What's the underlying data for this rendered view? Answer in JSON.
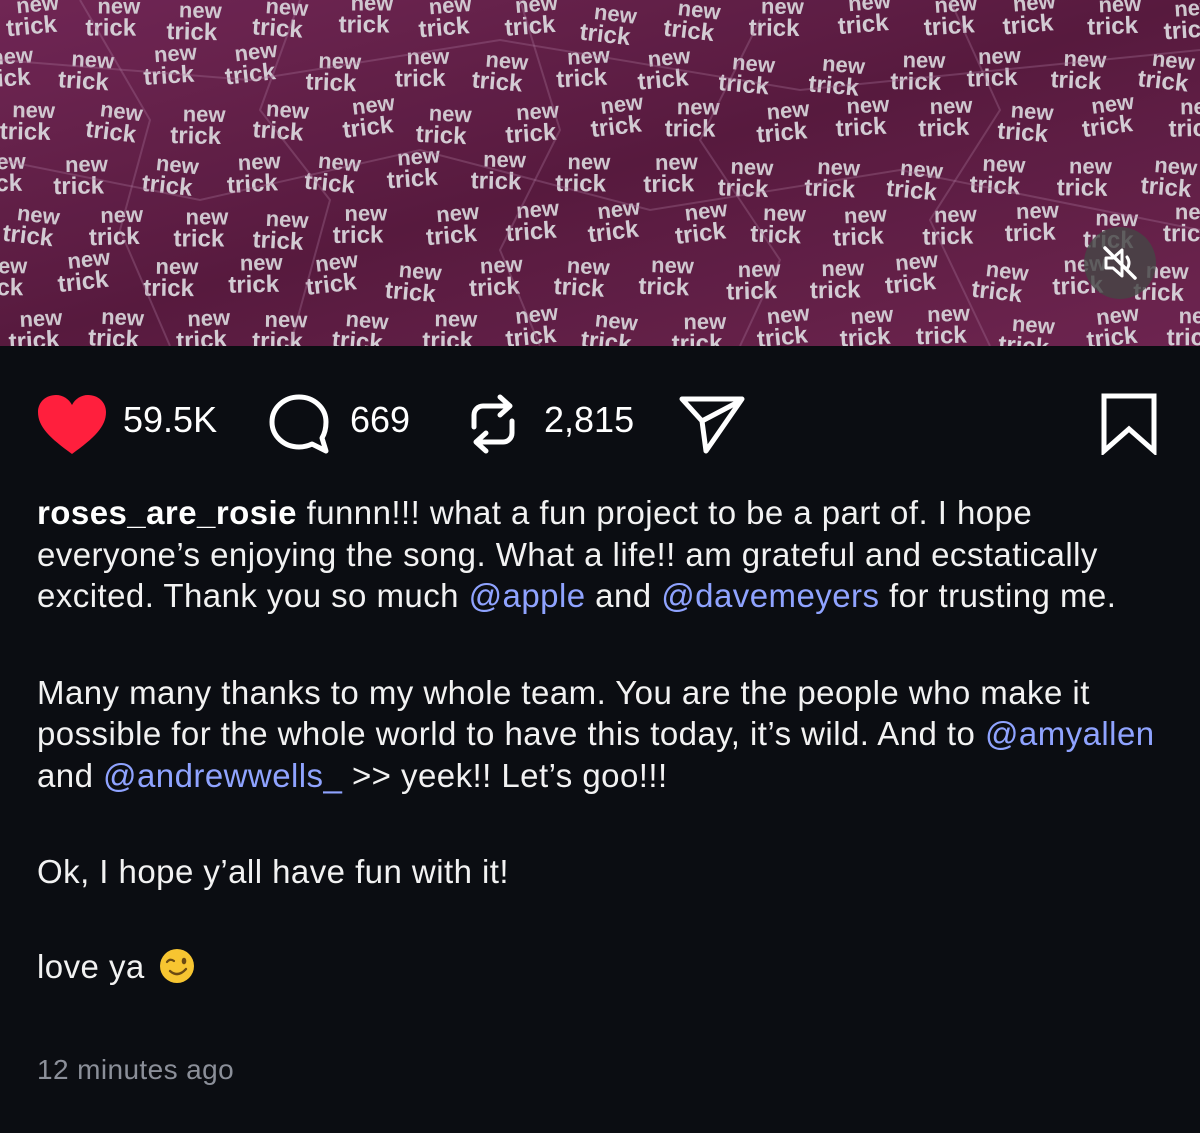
{
  "post": {
    "media_pattern_words": [
      "new",
      "trick"
    ],
    "actions": {
      "likes": "59.5K",
      "comments": "669",
      "reposts": "2,815"
    },
    "caption": {
      "username": "roses_are_rosie",
      "p1_a": " funnn!!! what a fun project to be a part of. I hope everyone’s enjoying the song. What a life!! am grateful and ecstatically excited. Thank you so much ",
      "mention_1": "@apple",
      "p1_b": " and ",
      "mention_2": "@davemeyers",
      "p1_c": " for trusting me.",
      "p2_a": "Many many thanks to my whole team. You are the people who make it possible for the whole world to have this today, it’s wild. And to ",
      "mention_3": "@amyallen",
      "p2_b": " and ",
      "mention_4": "@andrewwells_",
      "p2_c": " >> yeek!! Let’s goo!!!",
      "p3": "Ok, I hope y’all have fun with it!",
      "p4": "love ya"
    },
    "timestamp": "12 minutes ago"
  },
  "colors": {
    "background": "#0b0d12",
    "media_purple": "#6e2450",
    "like_red": "#ff1f3d",
    "mention_blue": "#8fa3ff",
    "timestamp_gray": "#8b8f99"
  },
  "icons": [
    "heart-icon",
    "comment-icon",
    "repost-icon",
    "share-icon",
    "bookmark-icon",
    "mute-icon",
    "wink-emoji"
  ]
}
